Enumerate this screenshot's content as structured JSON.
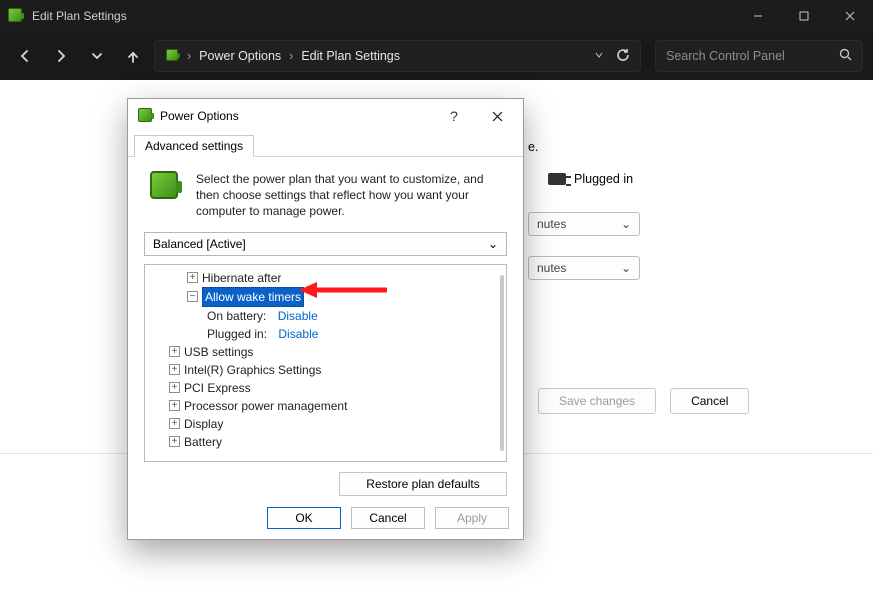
{
  "window": {
    "title": "Edit Plan Settings"
  },
  "nav": {
    "crumb_root": "Power Options",
    "crumb_leaf": "Edit Plan Settings",
    "search_placeholder": "Search Control Panel"
  },
  "bg": {
    "period_end": "e.",
    "plugged": "Plugged in",
    "sel1": "nutes",
    "sel2": "nutes",
    "save": "Save changes",
    "cancel": "Cancel"
  },
  "dialog": {
    "title": "Power Options",
    "tab": "Advanced settings",
    "desc": "Select the power plan that you want to customize, and then choose settings that reflect how you want your computer to manage power.",
    "plan": "Balanced [Active]",
    "restore": "Restore plan defaults",
    "ok": "OK",
    "cancel": "Cancel",
    "apply": "Apply"
  },
  "tree": {
    "hibernate": "Hibernate after",
    "wake": "Allow wake timers",
    "wake_batt_label": "On battery:",
    "wake_batt_val": "Disable",
    "wake_plug_label": "Plugged in:",
    "wake_plug_val": "Disable",
    "usb": "USB settings",
    "gfx": "Intel(R) Graphics Settings",
    "pci": "PCI Express",
    "proc": "Processor power management",
    "disp": "Display",
    "batt": "Battery"
  }
}
